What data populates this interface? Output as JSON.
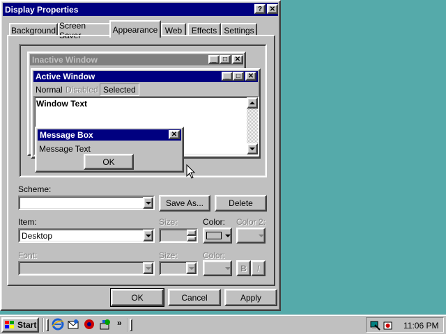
{
  "dialog": {
    "title": "Display Properties",
    "help_btn": "?",
    "close_btn": "✕",
    "tabs": [
      "Background",
      "Screen Saver",
      "Appearance",
      "Web",
      "Effects",
      "Settings"
    ],
    "active_tab": "Appearance",
    "preview": {
      "inactive_title": "Inactive Window",
      "active_title": "Active Window",
      "menu": [
        "Normal",
        "Disabled",
        "Selected"
      ],
      "window_text": "Window Text",
      "msgbox_title": "Message Box",
      "msgbox_text": "Message Text",
      "msgbox_ok": "OK"
    },
    "scheme": {
      "label": "Scheme:",
      "value": "",
      "save_as": "Save As...",
      "delete": "Delete"
    },
    "item": {
      "label": "Item:",
      "value": "Desktop",
      "size_label": "Size:",
      "color_label": "Color:",
      "color2_label": "Color 2:",
      "color_value": "#c0c0c0"
    },
    "font": {
      "label": "Font:",
      "size_label": "Size:",
      "color_label": "Color:",
      "bold": "B",
      "italic": "I"
    },
    "buttons": {
      "ok": "OK",
      "cancel": "Cancel",
      "apply": "Apply"
    }
  },
  "taskbar": {
    "start": "Start",
    "chevron": "»",
    "clock": "11:06 PM"
  },
  "colors": {
    "desktop": "#55aaaa",
    "title_active": "#000080",
    "title_inactive": "#808080"
  }
}
